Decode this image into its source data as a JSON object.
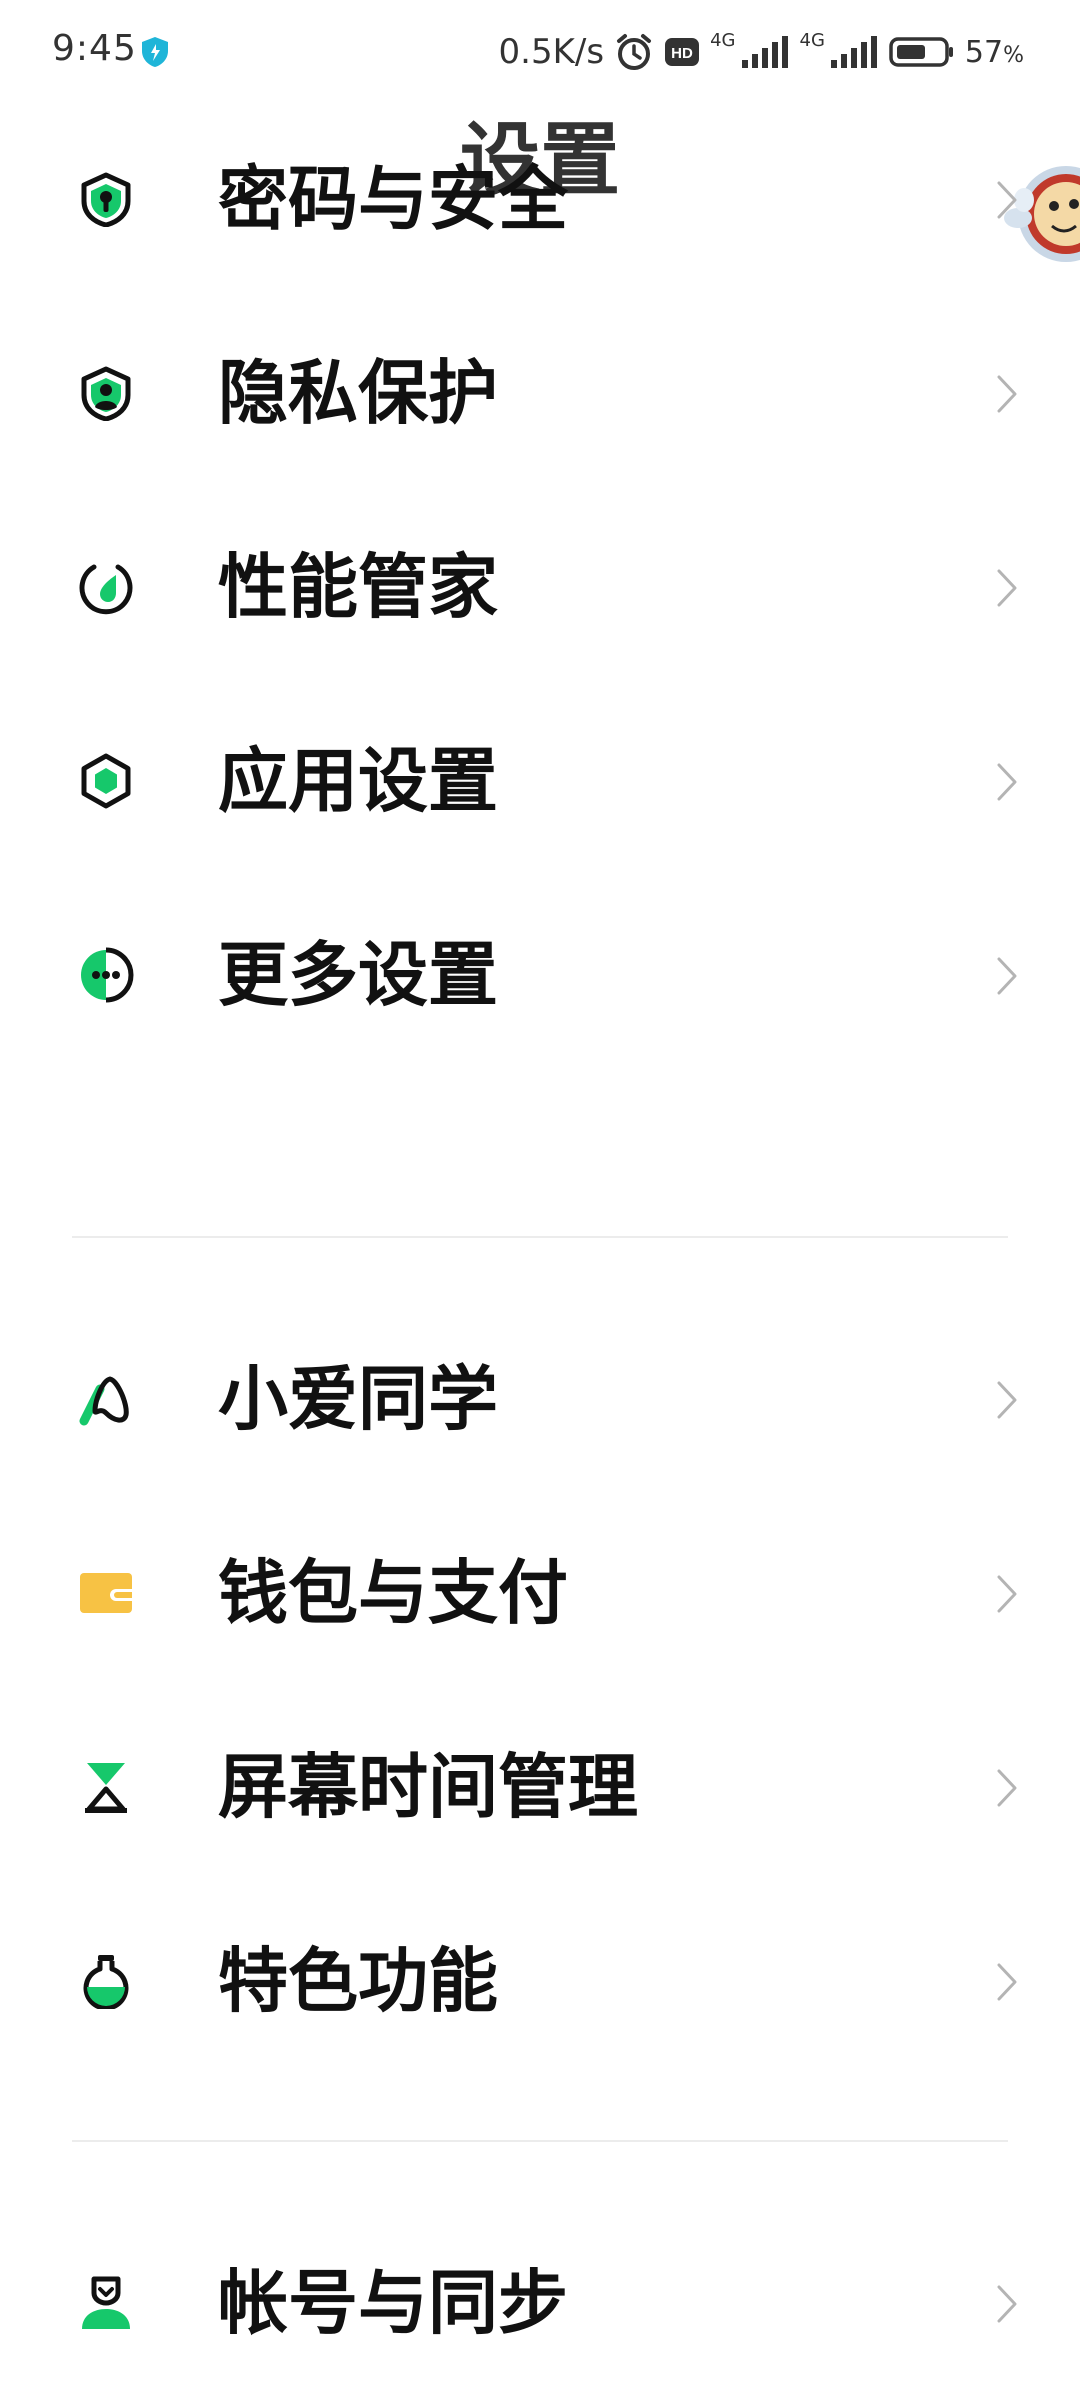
{
  "status_bar": {
    "time": "9:45",
    "net_speed": "0.5K/s",
    "network_1": "4G",
    "network_2": "4G",
    "battery_value": "57",
    "battery_unit": "%",
    "icons": [
      "vpn-shield-icon",
      "alarm-icon",
      "hd-icon",
      "signal-icon",
      "signal-icon",
      "battery-icon"
    ]
  },
  "page": {
    "title": "设置"
  },
  "colors": {
    "accent_green": "#16c86b",
    "icon_black": "#111111",
    "wallet_yellow": "#f7c244",
    "chevron": "#b4b4b4",
    "divider": "#ececec"
  },
  "groups": [
    {
      "items": [
        {
          "label": "密码与安全",
          "icon": "password-security-icon"
        },
        {
          "label": "隐私保护",
          "icon": "privacy-shield-icon"
        },
        {
          "label": "性能管家",
          "icon": "performance-gauge-icon"
        },
        {
          "label": "应用设置",
          "icon": "app-settings-icon"
        },
        {
          "label": "更多设置",
          "icon": "more-settings-icon"
        }
      ]
    },
    {
      "items": [
        {
          "label": "小爱同学",
          "icon": "xiaoai-assistant-icon"
        },
        {
          "label": "钱包与支付",
          "icon": "wallet-icon"
        },
        {
          "label": "屏幕时间管理",
          "icon": "hourglass-icon"
        },
        {
          "label": "特色功能",
          "icon": "flask-icon"
        }
      ]
    },
    {
      "items": [
        {
          "label": "帐号与同步",
          "icon": "account-sync-icon"
        }
      ]
    }
  ]
}
